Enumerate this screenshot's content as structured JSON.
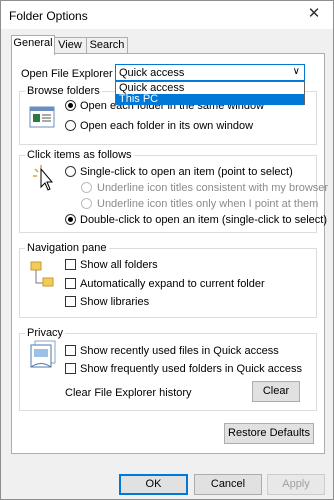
{
  "window": {
    "title": "Folder Options",
    "close_icon": "close-icon"
  },
  "tabs": [
    {
      "label": "General",
      "active": true
    },
    {
      "label": "View",
      "active": false
    },
    {
      "label": "Search",
      "active": false
    }
  ],
  "open_explorer": {
    "label": "Open File Explorer to:",
    "selected": "Quick access",
    "options": [
      "Quick access",
      "This PC"
    ],
    "highlighted": "This PC"
  },
  "browse_folders": {
    "legend": "Browse folders",
    "icon": "browse-folders-icon",
    "options": [
      {
        "label": "Open each folder in the same window",
        "selected": true
      },
      {
        "label": "Open each folder in its own window",
        "selected": false
      }
    ]
  },
  "click_items": {
    "legend": "Click items as follows",
    "icon": "pointer-click-icon",
    "single_click": "Single-click to open an item (point to select)",
    "underline_browser": "Underline icon titles consistent with my browser",
    "underline_point": "Underline icon titles only when I point at them",
    "double_click": "Double-click to open an item (single-click to select)"
  },
  "navigation_pane": {
    "legend": "Navigation pane",
    "icon": "folder-tree-icon",
    "show_all_folders": "Show all folders",
    "expand_current": "Automatically expand to current folder",
    "show_libraries": "Show libraries"
  },
  "privacy": {
    "legend": "Privacy",
    "icon": "privacy-icon",
    "recent_files": "Show recently used files in Quick access",
    "frequent_folders": "Show frequently used folders in Quick access",
    "clear_history_label": "Clear File Explorer history",
    "clear_button": "Clear"
  },
  "restore_defaults": "Restore Defaults",
  "footer": {
    "ok": "OK",
    "cancel": "Cancel",
    "apply": "Apply"
  },
  "colors": {
    "accent": "#0078d7",
    "window_bg": "#f0f0f0",
    "panel_bg": "#ffffff"
  }
}
